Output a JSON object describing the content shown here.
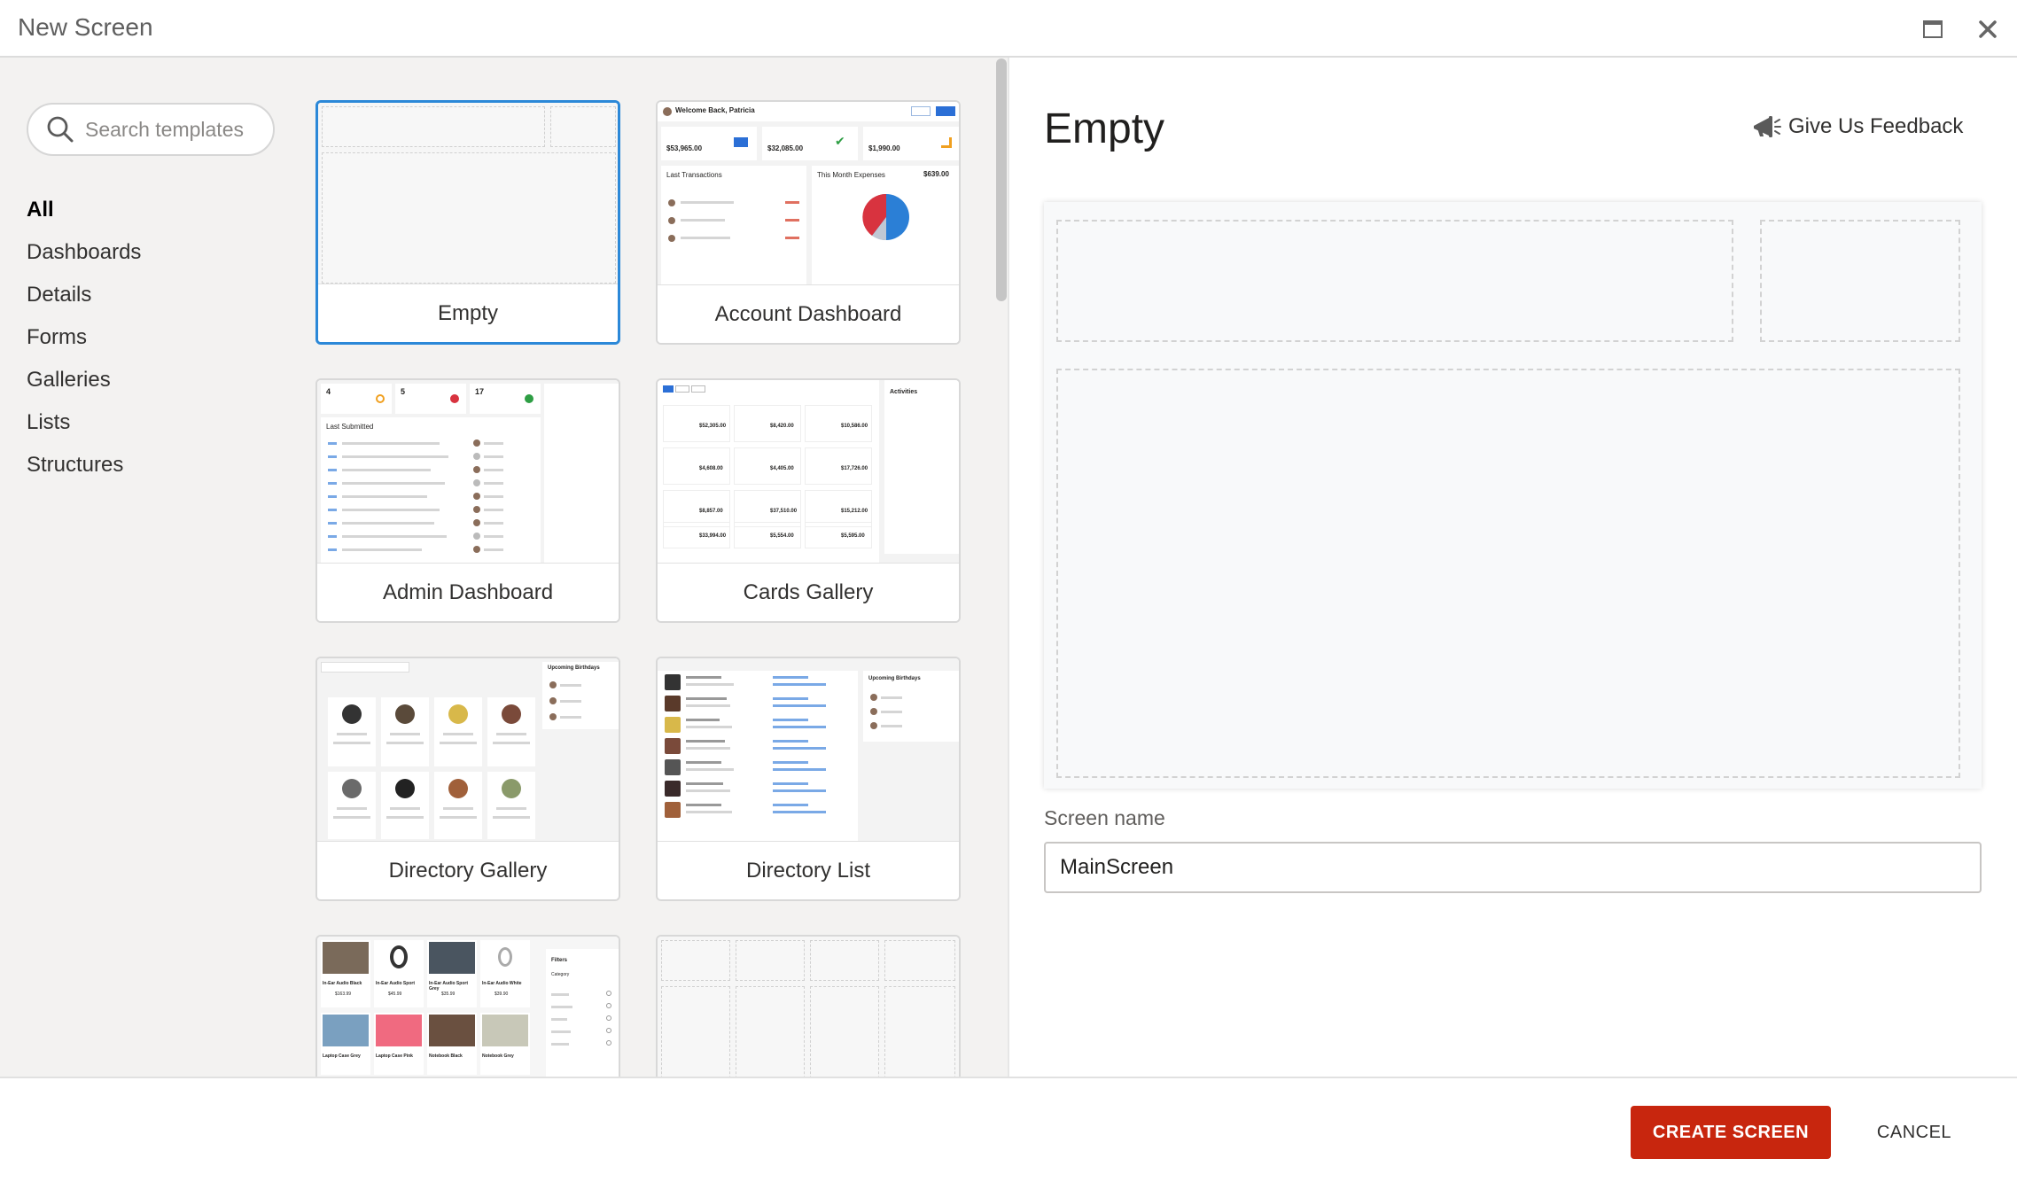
{
  "window": {
    "title": "New Screen",
    "maximize_icon": "maximize-icon",
    "close_icon": "close-icon"
  },
  "search": {
    "placeholder": "Search templates",
    "icon": "search-icon"
  },
  "categories": [
    {
      "label": "All",
      "active": true
    },
    {
      "label": "Dashboards"
    },
    {
      "label": "Details"
    },
    {
      "label": "Forms"
    },
    {
      "label": "Galleries"
    },
    {
      "label": "Lists"
    },
    {
      "label": "Structures"
    }
  ],
  "templates": [
    {
      "label": "Empty",
      "selected": true
    },
    {
      "label": "Account Dashboard"
    },
    {
      "label": "Admin Dashboard"
    },
    {
      "label": "Cards Gallery"
    },
    {
      "label": "Directory Gallery"
    },
    {
      "label": "Directory List"
    },
    {
      "label": ""
    },
    {
      "label": ""
    }
  ],
  "thumb_text": {
    "account": {
      "welcome": "Welcome Back, Patricia",
      "amounts": [
        "$53,965.00",
        "$32,085.00",
        "$1,990.00"
      ],
      "last_transactions": "Last Transactions",
      "month_expenses": "This Month Expenses",
      "expenses_total": "$639.00"
    },
    "admin": {
      "counts": [
        "4",
        "5",
        "17"
      ],
      "last_submitted": "Last Submitted"
    },
    "cards": {
      "activities": "Activities",
      "amounts": [
        "$52,305.00",
        "$8,420.00",
        "$10,586.00",
        "$4,608.00",
        "$4,405.00",
        "$17,726.00",
        "$8,857.00",
        "$37,510.00",
        "$15,212.00",
        "$33,994.00",
        "$5,554.00",
        "$5,595.00"
      ]
    },
    "directory_gallery": {
      "upcoming": "Upcoming Birthdays"
    },
    "directory_list": {
      "upcoming": "Upcoming Birthdays"
    },
    "products": {
      "filters": "Filters",
      "category": "Category",
      "items": [
        {
          "name": "In-Ear Audio Black",
          "price": "$163.99"
        },
        {
          "name": "In-Ear Audio Sport",
          "price": "$45.99"
        },
        {
          "name": "In-Ear Audio Sport Grey",
          "price": "$35.99"
        },
        {
          "name": "In-Ear Audio White",
          "price": "$39.90"
        },
        {
          "name": "Laptop Case Grey",
          "price": ""
        },
        {
          "name": "Laptop Case Pink",
          "price": ""
        },
        {
          "name": "Notebook Black",
          "price": ""
        },
        {
          "name": "Notebook Grey",
          "price": ""
        }
      ]
    }
  },
  "preview": {
    "title": "Empty",
    "feedback": "Give Us Feedback",
    "feedback_icon": "megaphone-icon"
  },
  "screen_name": {
    "label": "Screen name",
    "value": "MainScreen"
  },
  "footer": {
    "create": "CREATE SCREEN",
    "cancel": "CANCEL"
  },
  "colors": {
    "accent": "#c8260e",
    "selection": "#2b88d8",
    "sidebar_bg": "#f3f2f1"
  }
}
